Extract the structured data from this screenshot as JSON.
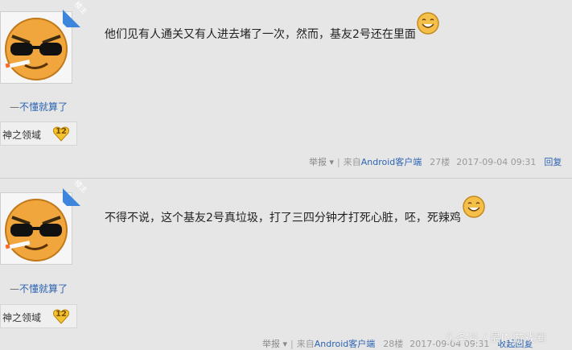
{
  "posts": [
    {
      "badge": "楼主",
      "username": "不懂就算了",
      "username_prefix": "—",
      "forum": "神之领域",
      "level": "12",
      "content": "他们见有人通关又有人进去堵了一次，然而，基友2号还在里面",
      "report": "举报",
      "from_prefix": "来自",
      "from_link": "Android客户端",
      "floor": "27楼",
      "time": "2017-09-04 09:31",
      "reply": "回复"
    },
    {
      "badge": "楼主",
      "username": "不懂就算了",
      "username_prefix": "—",
      "forum": "神之领域",
      "level": "12",
      "content": "不得不说，这个基友2号真垃圾，打了三四分钟才打死心脏，呸，死辣鸡",
      "report": "举报",
      "from_prefix": "来自",
      "from_link": "Android客户端",
      "floor": "28楼",
      "time": "2017-09-04 09:31",
      "reply": "收起回复"
    }
  ],
  "watermark": "头条号 / 最IN游戏圈",
  "colors": {
    "link": "#2d64b3",
    "badge": "#3d86dc",
    "background": "#e6e6e6"
  },
  "icons": [
    "dropdown-caret-icon",
    "smiley-emoji-icon",
    "level-heart-icon",
    "sunglasses-avatar-icon"
  ]
}
